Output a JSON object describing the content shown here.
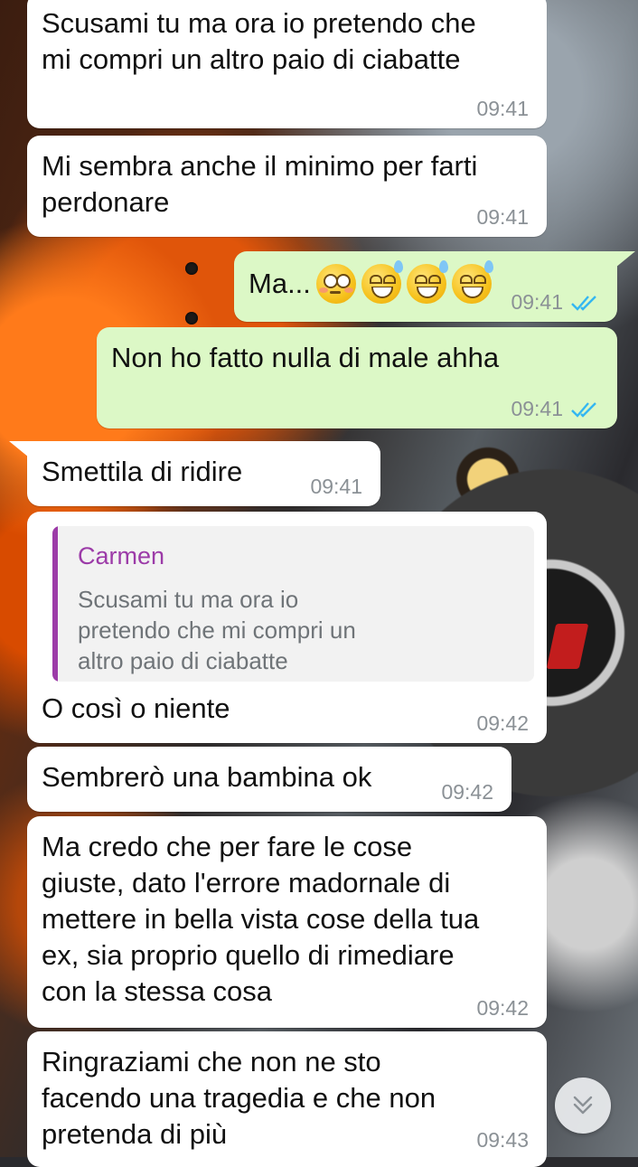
{
  "messages": [
    {
      "id": "m1",
      "direction": "incoming",
      "text": "Scusami tu ma ora io pretendo che\nmi compri un altro paio di ciabatte",
      "time": "09:41"
    },
    {
      "id": "m2",
      "direction": "incoming",
      "text": "Mi sembra anche il minimo per farti\nperdonare",
      "time": "09:41"
    },
    {
      "id": "m3",
      "direction": "outgoing",
      "text": "Ma...",
      "emojis": [
        "flushed-face-emoji",
        "grinning-sweat-emoji",
        "grinning-sweat-emoji",
        "grinning-sweat-emoji"
      ],
      "time": "09:41",
      "status": "read"
    },
    {
      "id": "m4",
      "direction": "outgoing",
      "text": "Non ho fatto nulla di male ahha",
      "time": "09:41",
      "status": "read"
    },
    {
      "id": "m5",
      "direction": "incoming",
      "text": "Smettila di ridire",
      "time": "09:41"
    },
    {
      "id": "m6",
      "direction": "incoming",
      "text": "O così o niente",
      "time": "09:42",
      "reply_to": {
        "author": "Carmen",
        "text": "Scusami tu ma ora io\npretendo che mi compri un\naltro paio di ciabatte"
      }
    },
    {
      "id": "m7",
      "direction": "incoming",
      "text": "Sembrerò una bambina ok",
      "time": "09:42"
    },
    {
      "id": "m8",
      "direction": "incoming",
      "text": "Ma credo che per fare le cose\ngiuste, dato l'errore madornale di\nmettere in bella vista cose della tua\nex, sia proprio quello di rimediare\ncon la stessa cosa",
      "time": "09:42"
    },
    {
      "id": "m9",
      "direction": "incoming",
      "text": "Ringraziami che non ne sto\nfacendo una tragedia e che non\npretenda di più",
      "time": "09:43"
    }
  ],
  "scroll_to_bottom": {
    "icon": "chevron-double-down-icon"
  },
  "colors": {
    "incoming_bubble": "#ffffff",
    "outgoing_bubble": "#dcf8c6",
    "read_ticks": "#34b7f1",
    "timestamp": "#8b9196",
    "quote_author": "#9c3ba8"
  }
}
